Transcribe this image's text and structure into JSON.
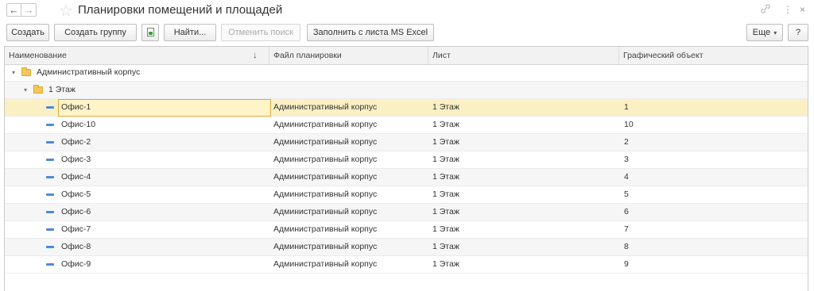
{
  "window": {
    "title": "Планировки помещений и площадей",
    "back_glyph": "←",
    "forward_glyph": "→",
    "star_glyph": "☆",
    "link_glyph": "🔗",
    "menu_glyph": "⋮",
    "close_glyph": "×"
  },
  "toolbar": {
    "create": "Создать",
    "create_group": "Создать группу",
    "find": "Найти...",
    "cancel_search": "Отменить поиск",
    "fill_excel": "Заполнить с листа MS Excel",
    "more": "Еще",
    "help": "?"
  },
  "table": {
    "columns": [
      "Наименование",
      "Файл планировки",
      "Лист",
      "Графический объект"
    ],
    "sort_indicator": "↓",
    "group_rows": [
      {
        "label": "Административный корпус"
      },
      {
        "label": "1 Этаж"
      }
    ],
    "rows": [
      {
        "name": "Офис-1",
        "file": "Административный корпус",
        "sheet": "1 Этаж",
        "object": "1"
      },
      {
        "name": "Офис-10",
        "file": "Административный корпус",
        "sheet": "1 Этаж",
        "object": "10"
      },
      {
        "name": "Офис-2",
        "file": "Административный корпус",
        "sheet": "1 Этаж",
        "object": "2"
      },
      {
        "name": "Офис-3",
        "file": "Административный корпус",
        "sheet": "1 Этаж",
        "object": "3"
      },
      {
        "name": "Офис-4",
        "file": "Административный корпус",
        "sheet": "1 Этаж",
        "object": "4"
      },
      {
        "name": "Офис-5",
        "file": "Административный корпус",
        "sheet": "1 Этаж",
        "object": "5"
      },
      {
        "name": "Офис-6",
        "file": "Административный корпус",
        "sheet": "1 Этаж",
        "object": "6"
      },
      {
        "name": "Офис-7",
        "file": "Административный корпус",
        "sheet": "1 Этаж",
        "object": "7"
      },
      {
        "name": "Офис-8",
        "file": "Административный корпус",
        "sheet": "1 Этаж",
        "object": "8"
      },
      {
        "name": "Офис-9",
        "file": "Административный корпус",
        "sheet": "1 Этаж",
        "object": "9"
      }
    ]
  }
}
